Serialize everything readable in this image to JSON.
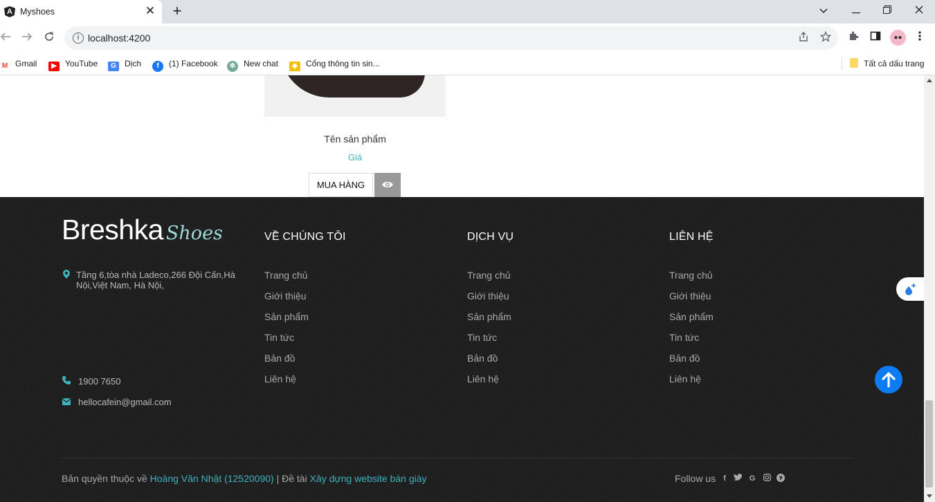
{
  "browser": {
    "tab_title": "Myshoes",
    "tab_close": "✕",
    "new_tab": "+",
    "url": "localhost:4200",
    "bookmarks": [
      {
        "label": "Gmail",
        "icon": "gmail-icon"
      },
      {
        "label": "YouTube",
        "icon": "youtube-icon"
      },
      {
        "label": "Dịch",
        "icon": "translate-icon"
      },
      {
        "label": "(1) Facebook",
        "icon": "facebook-icon"
      },
      {
        "label": "New chat",
        "icon": "chatgpt-icon"
      },
      {
        "label": "Cổng thông tin sin...",
        "icon": "portal-icon"
      }
    ],
    "all_bookmarks": "Tất cả dấu trang"
  },
  "product": {
    "name": "Tên sản phẩm",
    "price": "Giá",
    "buy_label": "MUA HÀNG"
  },
  "footer": {
    "logo_main": "Breshka",
    "logo_script": "Shoes",
    "address": "Tầng 6,tòa nhà Ladeco,266 Đội Cấn,Hà Nội,Việt Nam, Hà Nội,",
    "phone": "1900 7650",
    "email": "hellocafein@gmail.com",
    "columns": [
      {
        "title": "VỀ CHÚNG TÔI",
        "links": [
          "Trang chủ",
          "Giới thiệu",
          "Sản phẩm",
          "Tin tức",
          "Bản đồ",
          "Liên hệ"
        ]
      },
      {
        "title": "DỊCH VỤ",
        "links": [
          "Trang chủ",
          "Giới thiệu",
          "Sản phẩm",
          "Tin tức",
          "Bản đồ",
          "Liên hệ"
        ]
      },
      {
        "title": "LIÊN HỆ",
        "links": [
          "Trang chủ",
          "Giới thiệu",
          "Sản phẩm",
          "Tin tức",
          "Bản đồ",
          "Liên hệ"
        ]
      }
    ],
    "copyright_prefix": "Bản quyền thuộc về",
    "author": "Hoàng Văn Nhật (12520090)",
    "topic_prefix": "| Đề tài",
    "topic": "Xây dựng website bán giày",
    "follow_label": "Follow us",
    "social": [
      "facebook-icon",
      "twitter-icon",
      "google-icon",
      "instagram-icon",
      "pinterest-icon"
    ]
  },
  "colors": {
    "accent": "#3eb2bd",
    "footer_bg": "#1e1e1e",
    "scroll_top": "#0d7cf2"
  }
}
